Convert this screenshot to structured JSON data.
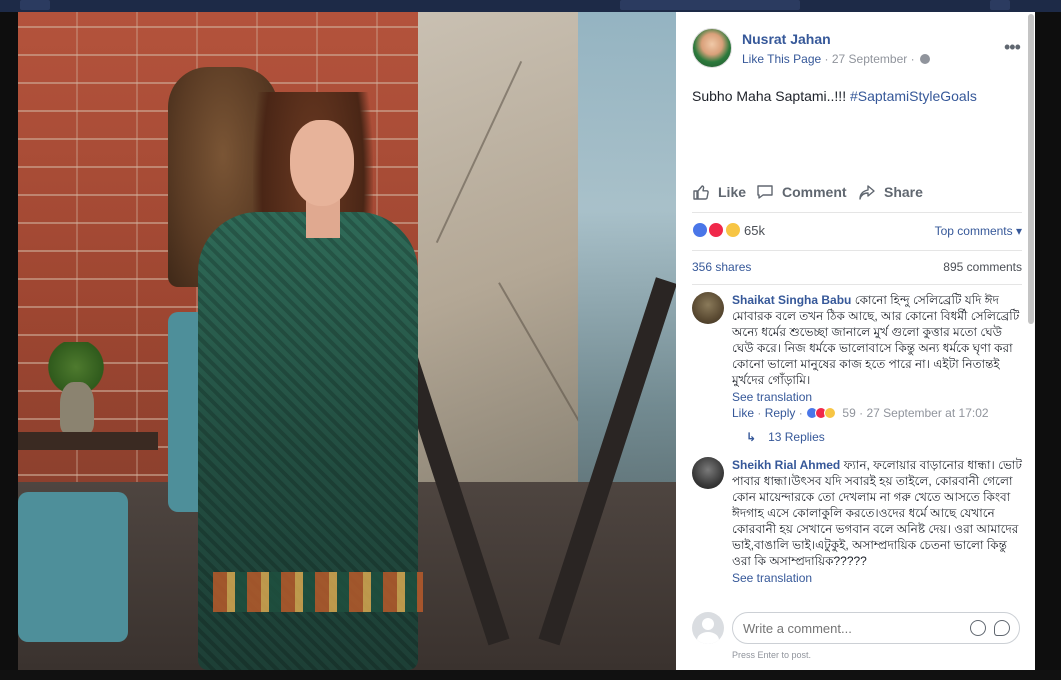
{
  "post": {
    "author": "Nusrat Jahan",
    "like_page": "Like This Page",
    "date": "27 September",
    "separator": "·",
    "text": "Subho Maha Saptami..!!! ",
    "hashtag": "#SaptamiStyleGoals"
  },
  "actions": {
    "like": "Like",
    "comment": "Comment",
    "share": "Share"
  },
  "reactions": {
    "count": "65k",
    "top_comments": "Top comments ▾",
    "shares": "356 shares",
    "comments": "895 comments",
    "icons": [
      "like-reaction-icon",
      "love-reaction-icon",
      "wow-reaction-icon"
    ]
  },
  "comments": [
    {
      "name": "Shaikat Singha Babu",
      "text": "কোনো হিন্দু সেলিব্রেটি যদি ঈদ মোবারক বলে তখন ঠিক আছে, আর কোনো বিধর্মী সেলিব্রেটি অন্যে ধর্মের শুভেচ্ছা জানালে মুর্খ গুলো কুত্তার মতো ঘেউ ঘেউ করে। নিজ ধর্মকে ভালোবাসে কিন্তু অন্য ধর্মকে ঘৃণা করা কোনো ভালো মানুষের কাজ হতে পারে না। এইটা নিতান্তই মুর্খদের গোঁড়ামি।",
      "translate": "See translation",
      "like": "Like",
      "reply": "Reply",
      "reaction_count": "59",
      "timestamp": "27 September at 17:02",
      "replies": "13 Replies"
    },
    {
      "name": "Sheikh Rial Ahmed",
      "text": "ফ্যান, ফলোয়ার বাড়ানোর ধান্ধা। ভোট পাবার ধান্ধা।উৎসব যদি সবারই হয় তাইলে, কোরবানী গেলো কোন মায়েন্দারকে তো দেখলাম না গরু খেতে আসতে কিংবা ঈদগাহ এসে কোলাকুলি করতে।ওদের ধর্মে আছে যেখানে কোরবানী হয় সেখানে ভগবান বলে অনিষ্ট দেয়। ওরা আমাদের ভাই,বাঙালি ভাই।এটুকুই, অসাম্প্রদায়িক চেতনা ভালো কিন্তু ওরা কি অসাম্প্রদায়িক?????",
      "translate": "See translation"
    }
  ],
  "composer": {
    "placeholder": "Write a comment...",
    "hint": "Press Enter to post."
  },
  "colors": {
    "link": "#365899",
    "muted": "#90949c",
    "text": "#1d2129",
    "like_blue": "#4a76e8",
    "love_red": "#f0284a",
    "wow_yellow": "#f7c544"
  }
}
